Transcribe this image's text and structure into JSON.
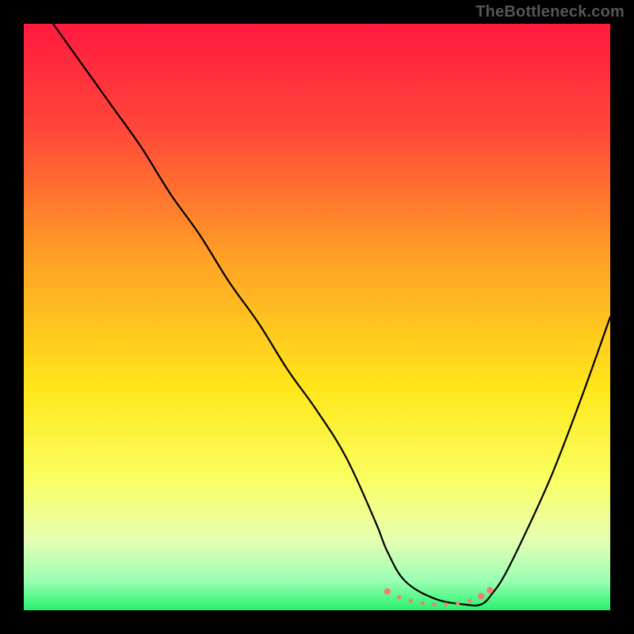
{
  "watermark": "TheBottleneck.com",
  "chart_data": {
    "type": "line",
    "title": "",
    "xlabel": "",
    "ylabel": "",
    "xlim": [
      0,
      100
    ],
    "ylim": [
      0,
      100
    ],
    "gradient_stops": [
      {
        "offset": 0,
        "color": "#ff1a3f"
      },
      {
        "offset": 18,
        "color": "#ff4739"
      },
      {
        "offset": 40,
        "color": "#ffa125"
      },
      {
        "offset": 62,
        "color": "#ffe61a"
      },
      {
        "offset": 78,
        "color": "#f9ff63"
      },
      {
        "offset": 88,
        "color": "#e6ffb3"
      },
      {
        "offset": 95,
        "color": "#99ffb3"
      },
      {
        "offset": 100,
        "color": "#29f26d"
      }
    ],
    "series": [
      {
        "name": "bottleneck-curve",
        "x": [
          5,
          10,
          15,
          20,
          25,
          30,
          35,
          40,
          45,
          50,
          55,
          60,
          62,
          65,
          70,
          75,
          78,
          80,
          82,
          85,
          90,
          95,
          100
        ],
        "y": [
          100,
          93,
          86,
          79,
          71,
          64,
          56,
          49,
          41,
          34,
          26,
          15,
          10,
          5,
          2,
          1,
          1,
          3,
          6,
          12,
          23,
          36,
          50
        ]
      }
    ],
    "marker_band": {
      "name": "optimal-range",
      "color": "#f08073",
      "radius_main": 4.2,
      "radius_small": 2.6,
      "points_x": [
        62,
        64,
        66,
        68,
        70,
        72,
        74,
        76,
        78,
        79.5
      ],
      "points_y": [
        3.2,
        2.2,
        1.6,
        1.2,
        1.0,
        1.0,
        1.2,
        1.6,
        2.4,
        3.4
      ]
    }
  }
}
